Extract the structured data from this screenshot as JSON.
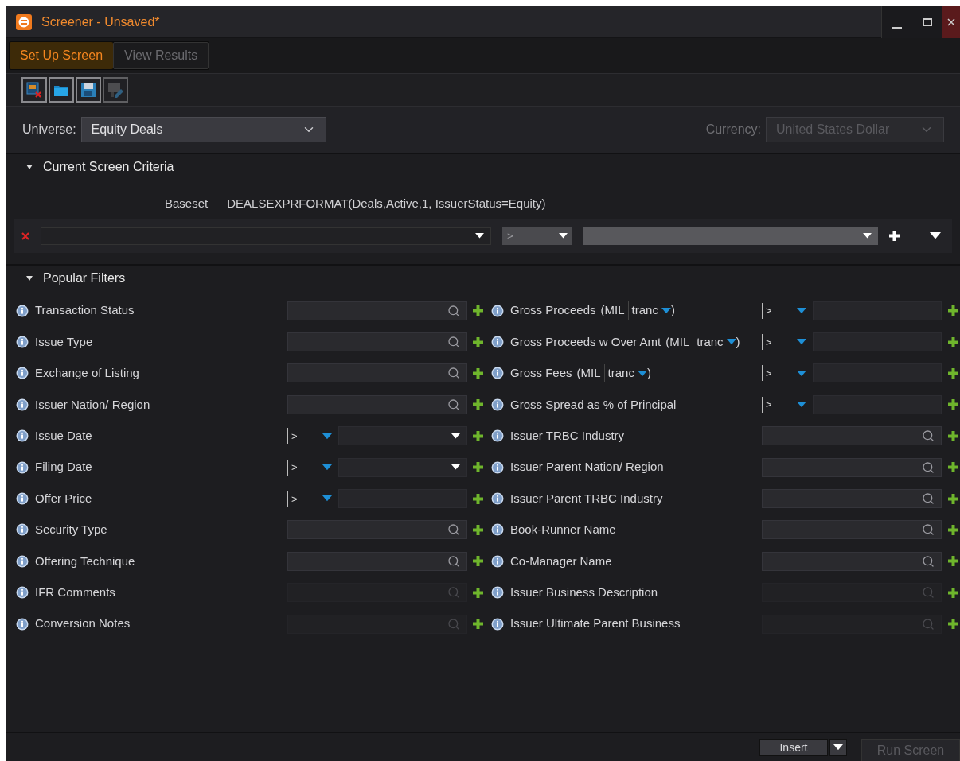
{
  "window": {
    "title": "Screener - Unsaved*"
  },
  "tabs": [
    {
      "label": "Set Up Screen",
      "selected": true
    },
    {
      "label": "View Results",
      "selected": false
    }
  ],
  "toolbar": [
    {
      "kind": "clear",
      "disabled": false
    },
    {
      "kind": "open",
      "disabled": false
    },
    {
      "kind": "save",
      "disabled": false
    },
    {
      "kind": "save_as",
      "disabled": true
    }
  ],
  "universe": {
    "label": "Universe:",
    "value": "Equity Deals"
  },
  "currency": {
    "label": "Currency:",
    "value": "United States Dollar",
    "disabled": true
  },
  "criteria": {
    "title": "Current Screen Criteria",
    "expanded": true,
    "baseset_label": "Baseset",
    "baseset_value": "DEALSEXPRFORMAT(Deals,Active,1, IssuerStatus=Equity)",
    "operator": ">"
  },
  "popular_filters": {
    "title": "Popular Filters",
    "expanded": true,
    "left": [
      {
        "label": "Transaction Status",
        "kind": "search",
        "disabled": false
      },
      {
        "label": "Issue Type",
        "kind": "search",
        "disabled": false
      },
      {
        "label": "Exchange of Listing",
        "kind": "search",
        "disabled": false
      },
      {
        "label": "Issuer Nation/ Region",
        "kind": "search",
        "disabled": false
      },
      {
        "label": "Issue Date",
        "kind": "date",
        "operator": ">"
      },
      {
        "label": "Filing Date",
        "kind": "date",
        "operator": ">"
      },
      {
        "label": "Offer Price",
        "kind": "number",
        "operator": ">"
      },
      {
        "label": "Security Type",
        "kind": "search",
        "disabled": false
      },
      {
        "label": "Offering Technique",
        "kind": "search",
        "disabled": false
      },
      {
        "label": "IFR Comments",
        "kind": "search",
        "disabled": true
      },
      {
        "label": "Conversion Notes",
        "kind": "search",
        "disabled": true
      }
    ],
    "right": [
      {
        "label": "Gross Proceeds",
        "unit": "(MIL",
        "basis": "tranc",
        "close": ")",
        "kind": "number",
        "operator": ">"
      },
      {
        "label": "Gross Proceeds w Over Amt",
        "unit": "(MIL",
        "basis": "tranc",
        "close": ")",
        "kind": "number",
        "operator": ">"
      },
      {
        "label": "Gross Fees",
        "unit": "(MIL",
        "basis": "tranc",
        "close": ")",
        "kind": "number",
        "operator": ">"
      },
      {
        "label": "Gross Spread as % of Principal",
        "kind": "number",
        "operator": ">"
      },
      {
        "label": "Issuer TRBC Industry",
        "kind": "search",
        "disabled": false
      },
      {
        "label": "Issuer Parent Nation/ Region",
        "kind": "search",
        "disabled": false
      },
      {
        "label": "Issuer Parent TRBC Industry",
        "kind": "search",
        "disabled": false
      },
      {
        "label": "Book-Runner Name",
        "kind": "search",
        "disabled": false
      },
      {
        "label": "Co-Manager Name",
        "kind": "search",
        "disabled": false
      },
      {
        "label": "Issuer Business Description",
        "kind": "search",
        "disabled": true
      },
      {
        "label": "Issuer Ultimate Parent Business",
        "kind": "search",
        "disabled": true
      }
    ]
  },
  "footer": {
    "insert": "Insert",
    "run": "Run Screen",
    "run_disabled": true
  }
}
